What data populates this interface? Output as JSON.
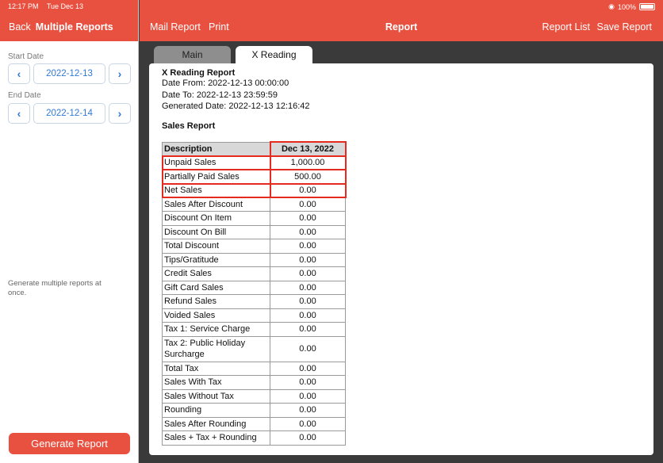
{
  "status_bar": {
    "time": "12:17 PM",
    "date": "Tue Dec 13",
    "battery": "100%"
  },
  "left_panel": {
    "back_label": "Back",
    "title": "Multiple Reports",
    "start_date_label": "Start Date",
    "start_date": "2022-12-13",
    "end_date_label": "End Date",
    "end_date": "2022-12-14",
    "hint": "Generate multiple reports at once.",
    "generate_button": "Generate Report"
  },
  "header": {
    "mail_report": "Mail Report",
    "print": "Print",
    "title": "Report",
    "report_list": "Report List",
    "save_report": "Save Report"
  },
  "tabs": [
    {
      "label": "Main",
      "active": false
    },
    {
      "label": "X Reading",
      "active": true
    }
  ],
  "report": {
    "title": "X Reading Report",
    "date_from": "Date From: 2022-12-13 00:00:00",
    "date_to": "Date To: 2022-12-13 23:59:59",
    "generated": "Generated Date: 2022-12-13 12:16:42",
    "section": "Sales Report",
    "columns": [
      "Description",
      "Dec 13, 2022"
    ],
    "rows": [
      {
        "desc": "Unpaid Sales",
        "value": "1,000.00",
        "highlight": true
      },
      {
        "desc": "Partially Paid Sales",
        "value": "500.00",
        "highlight": true
      },
      {
        "desc": "Net Sales",
        "value": "0.00",
        "highlight": true
      },
      {
        "desc": "Sales After Discount",
        "value": "0.00"
      },
      {
        "desc": "Discount On Item",
        "value": "0.00"
      },
      {
        "desc": "Discount On Bill",
        "value": "0.00"
      },
      {
        "desc": "Total Discount",
        "value": "0.00"
      },
      {
        "desc": "Tips/Gratitude",
        "value": "0.00"
      },
      {
        "desc": "Credit Sales",
        "value": "0.00"
      },
      {
        "desc": "Gift Card Sales",
        "value": "0.00"
      },
      {
        "desc": "Refund Sales",
        "value": "0.00"
      },
      {
        "desc": "Voided Sales",
        "value": "0.00"
      },
      {
        "desc": "Tax 1: Service Charge",
        "value": "0.00"
      },
      {
        "desc": "Tax 2: Public Holiday Surcharge",
        "value": "0.00",
        "tall": true
      },
      {
        "desc": "Total Tax",
        "value": "0.00"
      },
      {
        "desc": "Sales With Tax",
        "value": "0.00"
      },
      {
        "desc": "Sales Without Tax",
        "value": "0.00"
      },
      {
        "desc": "Rounding",
        "value": "0.00"
      },
      {
        "desc": "Sales After Rounding",
        "value": "0.00"
      },
      {
        "desc": "Sales + Tax + Rounding",
        "value": "0.00"
      }
    ]
  },
  "colors": {
    "brand": "#e8503f",
    "link": "#2f7ad6",
    "highlight": "#e52b20"
  }
}
